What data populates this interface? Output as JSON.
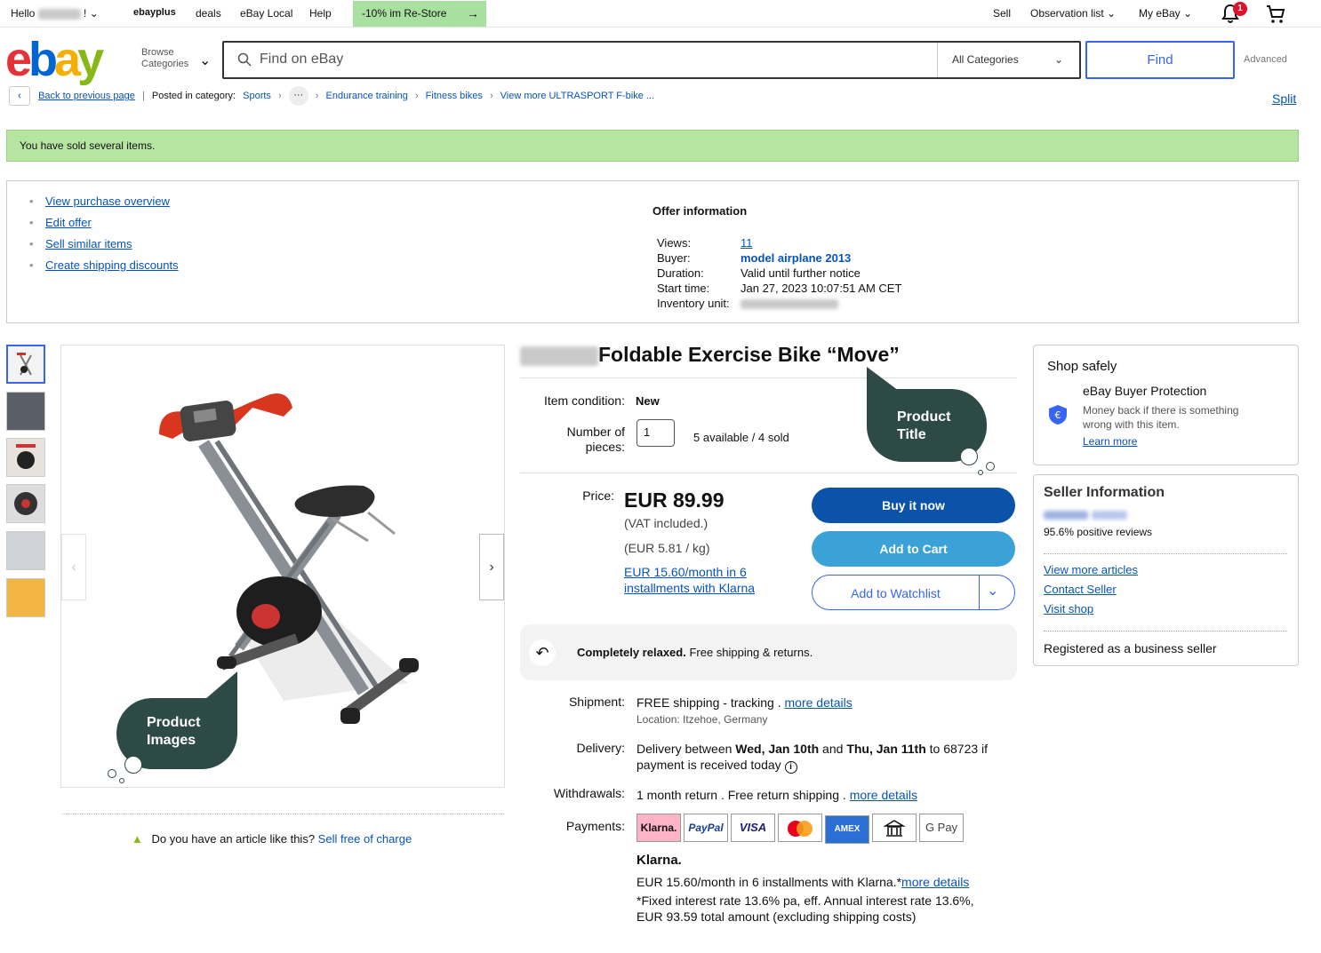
{
  "topbar": {
    "hello": "Hello",
    "hello_suffix": "!",
    "ebayplus": "ebayplus",
    "deals": "deals",
    "ebay_local": "eBay Local",
    "help": "Help",
    "promo": "-10% im Re-Store",
    "sell": "Sell",
    "watchlist": "Observation list",
    "my_ebay": "My eBay",
    "notification_count": "1"
  },
  "header": {
    "logo_letters": [
      "e",
      "b",
      "a",
      "y"
    ],
    "browse_line1": "Browse",
    "browse_line2": "Categories",
    "search_placeholder": "Find on eBay",
    "category": "All Categories",
    "find": "Find",
    "advanced": "Advanced"
  },
  "breadcrumb": {
    "back": "Back to previous page",
    "posted_in": "Posted in category:",
    "items": [
      "Sports",
      "Endurance training",
      "Fitness bikes",
      "View more ULTRASPORT F-bike ..."
    ],
    "split": "Split"
  },
  "notice": "You have sold several items.",
  "seller_links": [
    "View purchase overview",
    "Edit offer",
    "Sell similar items",
    "Create shipping discounts"
  ],
  "offer_info": {
    "heading": "Offer information",
    "rows": [
      {
        "key": "Views:",
        "value": "11"
      },
      {
        "key": "Buyer:",
        "value": "model airplane 2013"
      },
      {
        "key": "Duration:",
        "value": "Valid until further notice"
      },
      {
        "key": "Start time:",
        "value": "Jan 27, 2023 10:07:51 AM CET"
      },
      {
        "key": "Inventory unit:",
        "value": ""
      }
    ]
  },
  "product": {
    "title": "Foldable Exercise Bike “Move”",
    "condition_label": "Item condition:",
    "condition": "New",
    "qty_label_1": "Number of",
    "qty_label_2": "pieces:",
    "qty": "1",
    "availability": "5 available / 4 sold",
    "price_label": "Price:",
    "price": "EUR 89.99",
    "vat": "(VAT included.)",
    "unit_price": "(EUR 5.81 / kg)",
    "klarna_link_1": "EUR 15.60/month in 6",
    "klarna_link_2": "installments with Klarna",
    "buy_now": "Buy it now",
    "add_to_cart": "Add to Cart",
    "add_to_watchlist": "Add to Watchlist",
    "relaxed_bold": "Completely relaxed.",
    "relaxed_rest": " Free shipping & returns."
  },
  "shipping": {
    "shipment_label": "Shipment:",
    "shipment": "FREE shipping - tracking .",
    "more_details": "more details",
    "location": "Location: Itzehoe, Germany",
    "delivery_label": "Delivery:",
    "delivery_pre": "Delivery between ",
    "delivery_d1": "Wed, Jan 10th",
    "delivery_and": " and ",
    "delivery_d2": "Thu, Jan 11th",
    "delivery_post": " to 68723 if",
    "delivery_line2": "payment is received today",
    "withdrawals_label": "Withdrawals:",
    "withdrawals": "1 month return . Free return shipping .",
    "payments_label": "Payments:",
    "payment_methods": [
      "Klarna.",
      "PayPal",
      "VISA",
      "Mastercard",
      "AMEX",
      "Bank",
      "G Pay"
    ],
    "klarna_title": "Klarna.",
    "klarna_line1": "EUR 15.60/month in 6 installments with Klarna.*",
    "klarna_line2": "*Fixed interest rate 13.6% pa, eff. Annual interest rate 13.6%,",
    "klarna_line3": "EUR 93.59 total amount (excluding shipping costs)"
  },
  "shop_safely": {
    "title": "Shop safely",
    "protection": "eBay Buyer Protection",
    "desc_1": "Money back if there is something",
    "desc_2": "wrong with this item.",
    "learn_more": "Learn more"
  },
  "seller": {
    "title": "Seller Information",
    "reviews": "95.6% positive reviews",
    "links": [
      "View more articles",
      "Contact Seller",
      "Visit shop"
    ],
    "registered": "Registered as a business seller"
  },
  "annotations": {
    "product_title_1": "Product",
    "product_title_2": "Title",
    "product_images_1": "Product",
    "product_images_2": "Images"
  },
  "footer": {
    "question": "Do you have an article like this?",
    "sell_free": "Sell free of charge"
  },
  "colors": {
    "ebay_blue": "#3665f3",
    "buy_now": "#0a53a8",
    "add_to_cart": "#3aa2d7",
    "notice_green": "#b5e5a0",
    "annotation_bubble": "#2e4a47"
  }
}
